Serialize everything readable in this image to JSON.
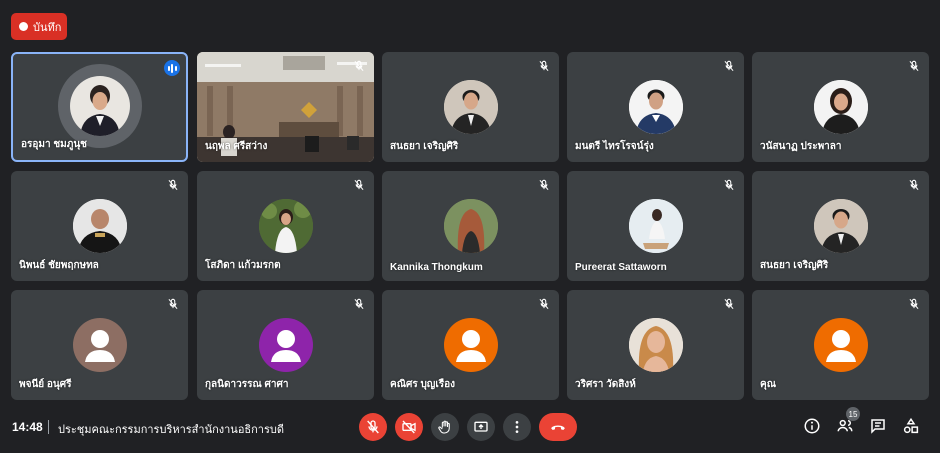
{
  "recording": {
    "label": "บันทึก"
  },
  "participants": [
    {
      "name": "อรอุมา ชมภูนุช",
      "speaking": true
    },
    {
      "name": "นฤพล ศรีสว่าง",
      "video": true
    },
    {
      "name": "สนธยา เจริญศิริ"
    },
    {
      "name": "มนตรี ไทรโรจน์รุ่ง"
    },
    {
      "name": "วนัสนาฏ ประพาลา"
    },
    {
      "name": "นิพนธ์ ชัยพฤกษทล"
    },
    {
      "name": "โสภิดา แก้วมรกต"
    },
    {
      "name": "Kannika Thongkum"
    },
    {
      "name": "Pureerat Sattaworn"
    },
    {
      "name": "สนธยา เจริญศิริ"
    },
    {
      "name": "พจนีย์ อนุศรี",
      "placeholder_color": "#8d6e63"
    },
    {
      "name": "กุลนิดาวรรณ ศาศา",
      "placeholder_color": "#8e24aa"
    },
    {
      "name": "คณิศร บุญเรือง",
      "placeholder_color": "#ef6c00"
    },
    {
      "name": "วริศรา วัดสิงห์"
    },
    {
      "name": "คุณ",
      "placeholder_color": "#ef6c00"
    }
  ],
  "bottom_bar": {
    "time": "14:48",
    "separator": "|",
    "meeting_title": "ประชุมคณะกรรมการบริหารสำนักงานอธิการบดี",
    "participant_count": "15"
  },
  "colors": {
    "background": "#202124",
    "tile": "#3c4043",
    "danger": "#ea4335",
    "accent": "#1a73e8",
    "active_border": "#8ab4f8"
  },
  "icons": {
    "mic": "mic-off-icon",
    "camera": "camera-off-icon",
    "hand": "raise-hand-icon",
    "present": "present-screen-icon",
    "more": "more-options-icon",
    "end": "end-call-icon",
    "info": "info-icon",
    "people": "people-icon",
    "chat": "chat-icon",
    "activities": "activities-icon"
  }
}
